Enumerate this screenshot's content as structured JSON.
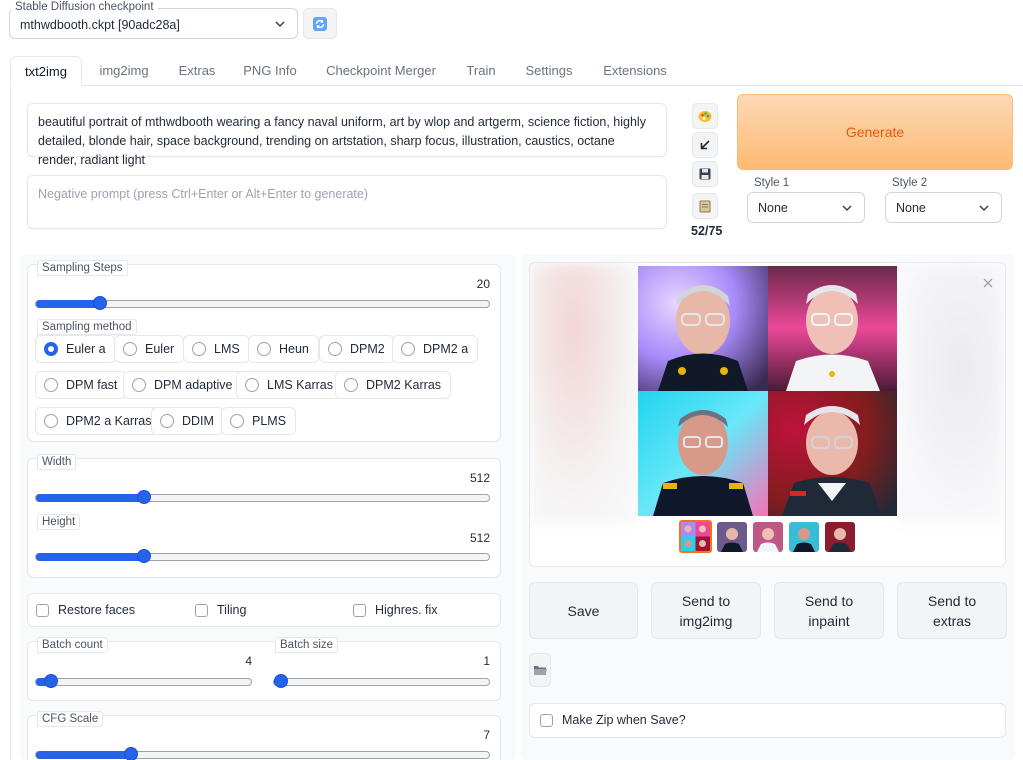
{
  "checkpoint": {
    "label": "Stable Diffusion checkpoint",
    "value": "mthwdbooth.ckpt [90adc28a]",
    "refresh_icon": "refresh-icon"
  },
  "tabs": [
    {
      "label": "txt2img",
      "active": true
    },
    {
      "label": "img2img"
    },
    {
      "label": "Extras"
    },
    {
      "label": "PNG Info"
    },
    {
      "label": "Checkpoint Merger"
    },
    {
      "label": "Train"
    },
    {
      "label": "Settings"
    },
    {
      "label": "Extensions"
    }
  ],
  "prompt": {
    "value": "beautiful portrait of mthwdbooth wearing a fancy naval uniform, art by wlop and artgerm, science fiction, highly detailed, blonde hair, space background, trending on artstation, sharp focus, illustration, caustics, octane render, radiant light"
  },
  "negative_prompt": {
    "placeholder": "Negative prompt (press Ctrl+Enter or Alt+Enter to generate)"
  },
  "tools": {
    "icons": [
      "palette-icon",
      "arrow-icon",
      "save-icon",
      "clipboard-icon"
    ],
    "token_count": "52/75"
  },
  "generate": {
    "label": "Generate"
  },
  "styles": {
    "style1": {
      "label": "Style 1",
      "value": "None"
    },
    "style2": {
      "label": "Style 2",
      "value": "None"
    }
  },
  "sampling_steps": {
    "label": "Sampling Steps",
    "value": "20",
    "fraction": 0.13
  },
  "sampling_method": {
    "label": "Sampling method",
    "options": [
      "Euler a",
      "Euler",
      "LMS",
      "Heun",
      "DPM2",
      "DPM2 a",
      "DPM fast",
      "DPM adaptive",
      "LMS Karras",
      "DPM2 Karras",
      "DPM2 a Karras",
      "DDIM",
      "PLMS"
    ],
    "selected": "Euler a"
  },
  "width": {
    "label": "Width",
    "value": "512",
    "fraction": 0.23
  },
  "height": {
    "label": "Height",
    "value": "512",
    "fraction": 0.23
  },
  "options": {
    "restore_faces": "Restore faces",
    "tiling": "Tiling",
    "highres_fix": "Highres. fix"
  },
  "batch_count": {
    "label": "Batch count",
    "value": "4",
    "fraction": 0.04
  },
  "batch_size": {
    "label": "Batch size",
    "value": "1",
    "fraction": 0.0
  },
  "cfg_scale": {
    "label": "CFG Scale",
    "value": "7",
    "fraction": 0.2
  },
  "gallery": {
    "close_icon": "close-icon",
    "thumbnail_count": 5
  },
  "actions": {
    "save": "Save",
    "send_img2img_1": "Send to",
    "send_img2img_2": "img2img",
    "send_inpaint_1": "Send to",
    "send_inpaint_2": "inpaint",
    "send_extras_1": "Send to",
    "send_extras_2": "extras",
    "folder_icon": "folder-icon"
  },
  "make_zip": {
    "label": "Make Zip when Save?"
  },
  "colors": {
    "accent": "#2563eb",
    "generate_bg": "#fdba74",
    "generate_text": "#ea580c"
  }
}
